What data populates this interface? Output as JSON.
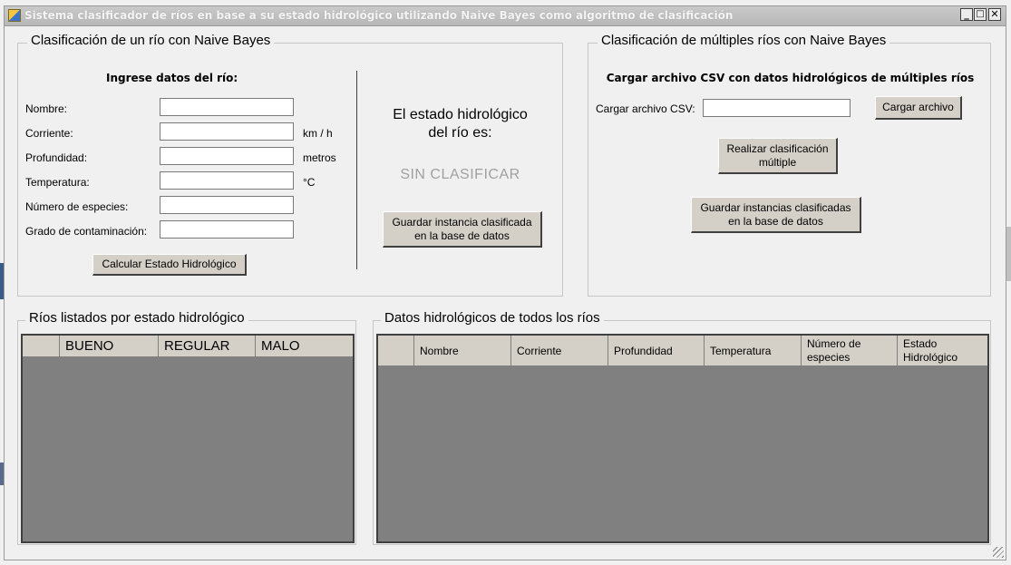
{
  "window": {
    "title": "Sistema clasificador de ríos en base a su estado hidrológico utilizando Naive Bayes como algoritmo de clasificación",
    "controls": {
      "minimize": "_",
      "maximize": "□",
      "close": "✕"
    }
  },
  "single": {
    "group_title": "Clasificación de un río con Naive Bayes",
    "heading": "Ingrese datos del río:",
    "fields": [
      {
        "label": "Nombre:",
        "value": "",
        "unit": ""
      },
      {
        "label": "Corriente:",
        "value": "",
        "unit": "km / h"
      },
      {
        "label": "Profundidad:",
        "value": "",
        "unit": "metros"
      },
      {
        "label": "Temperatura:",
        "value": "",
        "unit": "°C"
      },
      {
        "label": "Número de especies:",
        "value": "",
        "unit": ""
      },
      {
        "label": "Grado de contaminación:",
        "value": "",
        "unit": ""
      }
    ],
    "calc_button": "Calcular Estado Hidrológico",
    "result_heading": "El estado hidrológico\ndel río es:",
    "result_value": "SIN CLASIFICAR",
    "save_button": "Guardar instancia clasificada\nen la base de datos"
  },
  "multi": {
    "group_title": "Clasificación de múltiples ríos con Naive Bayes",
    "heading": "Cargar archivo CSV con datos hidrológicos de múltiples ríos",
    "csv_label": "Cargar archivo CSV:",
    "csv_value": "",
    "load_button": "Cargar archivo",
    "classify_button": "Realizar clasificación\nmúltiple",
    "save_button": "Guardar instancias clasificadas\nen la base de datos"
  },
  "by_state": {
    "group_title": "Ríos listados por estado hidrológico",
    "columns": [
      "BUENO",
      "REGULAR",
      "MALO"
    ]
  },
  "all_data": {
    "group_title": "Datos hidrológicos de todos los ríos",
    "columns": [
      "Nombre",
      "Corriente",
      "Profundidad",
      "Temperatura",
      "Número de\nespecies",
      "Estado\nHidrológico"
    ]
  }
}
